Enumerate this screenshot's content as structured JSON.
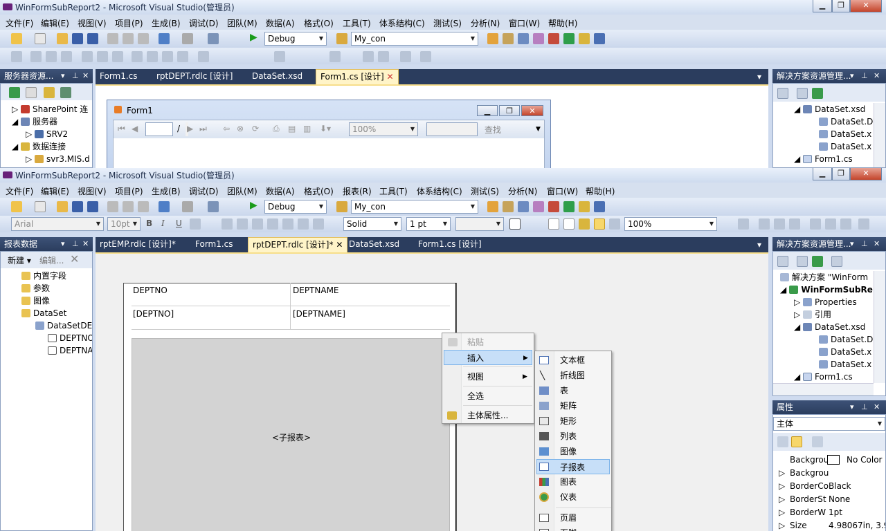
{
  "back_window": {
    "title": "WinFormSubReport2 - Microsoft Visual Studio(管理员)",
    "menu": [
      "文件(F)",
      "编辑(E)",
      "视图(V)",
      "项目(P)",
      "生成(B)",
      "调试(D)",
      "团队(M)",
      "数据(A)",
      "格式(O)",
      "工具(T)",
      "体系结构(C)",
      "测试(S)",
      "分析(N)",
      "窗口(W)",
      "帮助(H)"
    ],
    "config_combo": "Debug",
    "connection_combo": "My_con",
    "left_panel_title": "服务器资源...",
    "tabs": [
      "Form1.cs",
      "rptDEPT.rdlc [设计]",
      "DataSet.xsd",
      "Form1.cs [设计]"
    ],
    "tree": [
      "SharePoint 连",
      "服务器",
      "SRV2",
      "数据连接",
      "svr3.MIS.d"
    ],
    "form": {
      "title": "Form1",
      "zoom": "100%",
      "search": "查找",
      "page_sep": "/"
    },
    "right_panel_title": "解决方案资源管理...",
    "solution_tree": [
      "DataSet.xsd",
      "DataSet.D",
      "DataSet.x",
      "DataSet.x",
      "Form1.cs"
    ]
  },
  "front_window": {
    "title": "WinFormSubReport2 - Microsoft Visual Studio(管理员)",
    "menu": [
      "文件(F)",
      "编辑(E)",
      "视图(V)",
      "项目(P)",
      "生成(B)",
      "调试(D)",
      "团队(M)",
      "数据(A)",
      "格式(O)",
      "报表(R)",
      "工具(T)",
      "体系结构(C)",
      "测试(S)",
      "分析(N)",
      "窗口(W)",
      "帮助(H)"
    ],
    "config_combo": "Debug",
    "connection_combo": "My_con",
    "format_toolbar": {
      "font": "Arial",
      "size": "10pt",
      "bold": "B",
      "italic": "I",
      "underline": "U",
      "border_style": "Solid",
      "border_width": "1 pt",
      "zoom": "100%"
    },
    "report_data_panel": {
      "title": "报表数据",
      "new": "新建",
      "edit": "编辑...",
      "items": [
        "内置字段",
        "参数",
        "图像",
        "DataSet",
        "DataSetDE",
        "DEPTNO",
        "DEPTNAME"
      ]
    },
    "tabs": [
      "rptEMP.rdlc [设计]*",
      "Form1.cs",
      "rptDEPT.rdlc [设计]*",
      "DataSet.xsd",
      "Form1.cs [设计]"
    ],
    "table": {
      "headers": [
        "DEPTNO",
        "DEPTNAME"
      ],
      "cells": [
        "[DEPTNO]",
        "[DEPTNAME]"
      ]
    },
    "subreport_label": "<子报表>",
    "context_menu": [
      "粘贴",
      "插入",
      "视图",
      "全选",
      "主体属性..."
    ],
    "insert_submenu": [
      "文本框",
      "折线图",
      "表",
      "矩阵",
      "矩形",
      "列表",
      "图像",
      "子报表",
      "图表",
      "仪表",
      "页眉",
      "页脚"
    ],
    "solution_panel": {
      "title": "解决方案资源管理...",
      "items": [
        "解决方案 \"WinForm",
        "WinFormSubRe",
        "Properties",
        "引用",
        "DataSet.xsd",
        "DataSet.D",
        "DataSet.x",
        "DataSet.x",
        "Form1.cs"
      ]
    },
    "properties_panel": {
      "title": "属性",
      "object": "主体",
      "rows": [
        [
          "Backgrou",
          "No Color"
        ],
        [
          "Backgrou",
          ""
        ],
        [
          "BorderCo",
          "Black"
        ],
        [
          "BorderSt",
          "None"
        ],
        [
          "BorderW",
          "1pt"
        ],
        [
          "Size",
          "4.98067in, 3.9"
        ]
      ]
    }
  },
  "colors": {
    "chrome": "#cfdbef",
    "panel_header": "#2b3d5e",
    "tab_active": "#fff4c8",
    "selection": "#c7dff8",
    "subreport_fill": "#d3d3d3"
  }
}
